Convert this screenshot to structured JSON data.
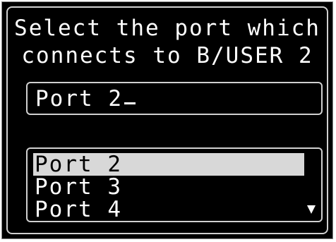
{
  "prompt": {
    "line1": "Select the port which",
    "line2": "connects to B/USER 2"
  },
  "entry": {
    "value": "Port 2"
  },
  "list": {
    "items": [
      "Port 2",
      "Port 3",
      "Port 4"
    ],
    "selected_index": 0
  },
  "icons": {
    "scroll": "scroll-down-arrow-icon"
  }
}
